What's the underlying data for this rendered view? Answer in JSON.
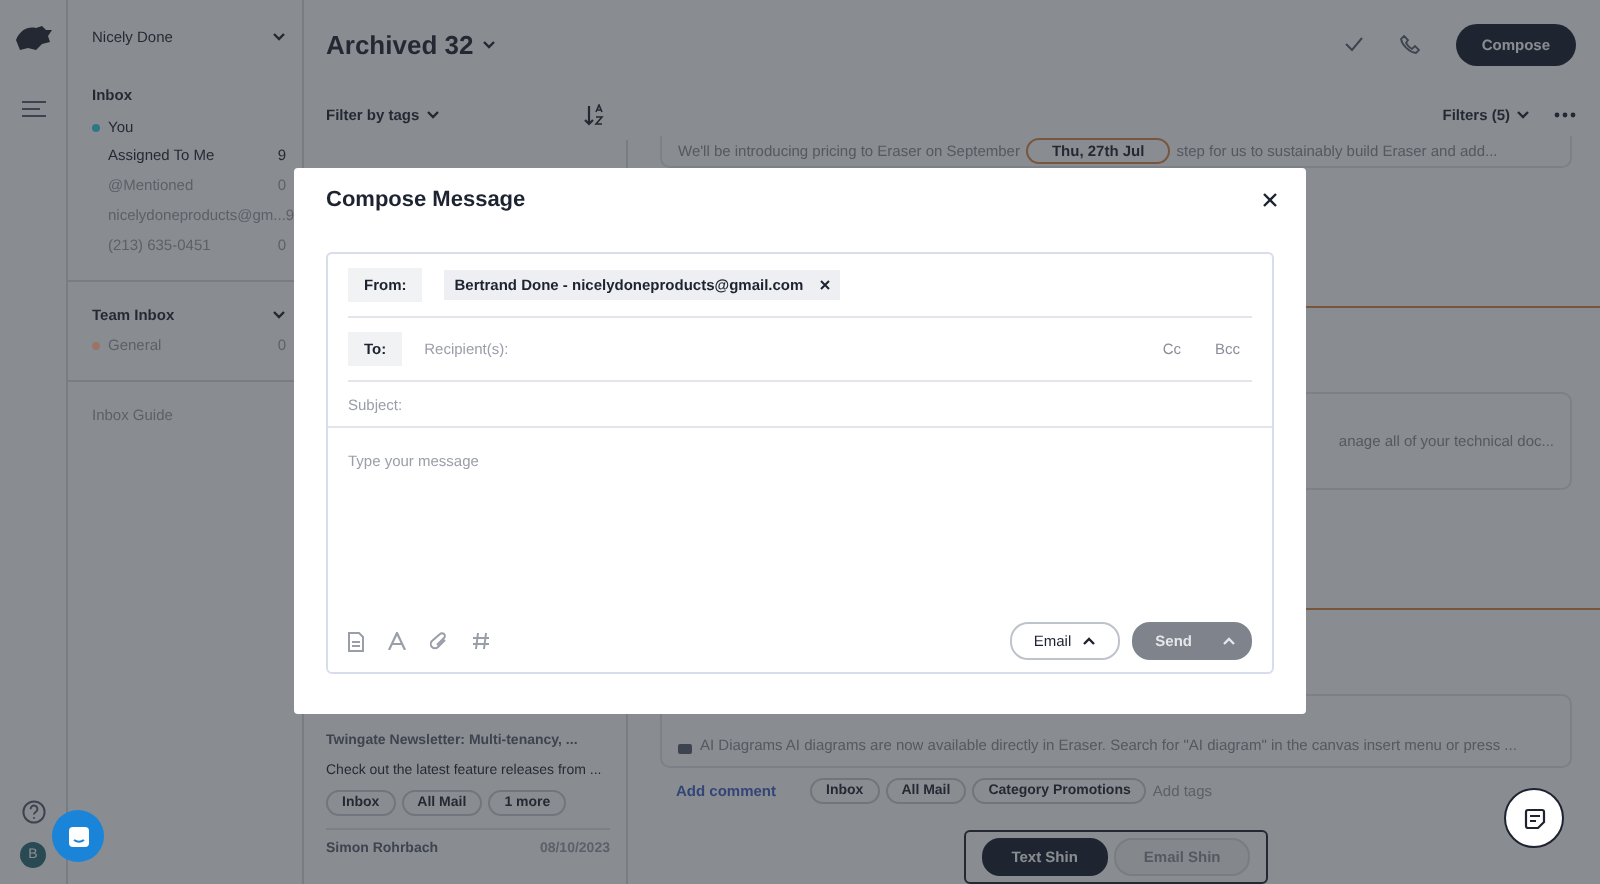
{
  "rail": {
    "avatar": "B"
  },
  "sidebar": {
    "account": "Nicely Done",
    "inbox": {
      "title": "Inbox",
      "owner": {
        "label": "You",
        "color": "#2f7882"
      },
      "items": [
        {
          "label": "Assigned To Me",
          "count": "9",
          "selected": true
        },
        {
          "label": "@Mentioned",
          "count": "0",
          "selected": false
        },
        {
          "label": "nicelydoneproducts@gm...",
          "count": "9",
          "selected": false
        },
        {
          "label": "(213) 635-0451",
          "count": "0",
          "selected": false
        }
      ]
    },
    "team_inbox": {
      "title": "Team Inbox",
      "items": [
        {
          "label": "General",
          "count": "0",
          "color": "#9a7466"
        }
      ]
    },
    "guide": "Inbox Guide"
  },
  "header": {
    "title": "Archived 32",
    "compose": "Compose",
    "filter_by_tags": "Filter by tags",
    "filters": "Filters (5)"
  },
  "list": {
    "items": [
      {
        "title": "Twingate Newsletter: Multi-tenancy, ...",
        "preview": "Check out the latest feature releases from ...",
        "tags": [
          "Inbox",
          "All Mail",
          "1 more"
        ]
      },
      {
        "sender": "Simon Rohrbach",
        "date": "08/10/2023"
      }
    ]
  },
  "detail": {
    "snippet_before": "We'll be introducing pricing to Eraser on September",
    "date_badge": "Thu, 27th Jul",
    "snippet_after": "step for us to sustainably build Eraser and add...",
    "snippet_docs": "anage all of your technical doc...",
    "snippet_ai": "AI Diagrams AI diagrams are now available directly in Eraser. Search for \"AI diagram\" in the canvas insert menu or press ...",
    "add_comment": "Add comment",
    "tags": [
      "Inbox",
      "All Mail",
      "Category Promotions"
    ],
    "add_tags": "Add tags",
    "channel_toggle": [
      {
        "label": "Text Shin",
        "selected": true
      },
      {
        "label": "Email Shin",
        "selected": false
      }
    ]
  },
  "modal": {
    "title": "Compose Message",
    "from_label": "From:",
    "from_value": "Bertrand Done - nicelydoneproducts@gmail.com",
    "to_label": "To:",
    "to_placeholder": "Recipient(s):",
    "cc": "Cc",
    "bcc": "Bcc",
    "subject_placeholder": "Subject:",
    "message_placeholder": "Type your message",
    "channel": "Email",
    "send": {
      "label": "Send",
      "disabled": true
    }
  }
}
